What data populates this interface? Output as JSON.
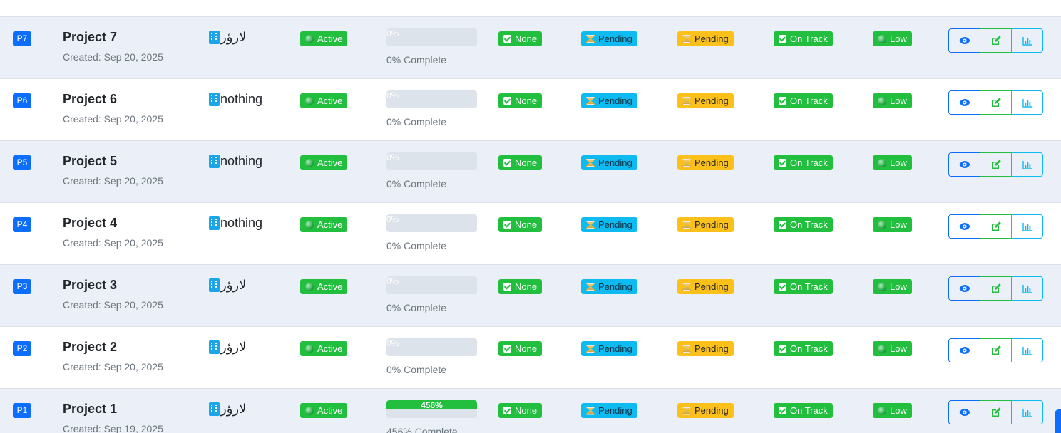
{
  "colors": {
    "primary": "#0d6efd",
    "success": "#22bf3f",
    "info": "#0dbbf0",
    "warning": "#fcc01a",
    "stripe": "#eaeff8"
  },
  "icons": {
    "department": "building-icon",
    "status": "green-dot-icon",
    "check": "check-square-icon",
    "pending": "hourglass-icon",
    "view": "eye-icon",
    "edit": "edit-icon",
    "chart": "bar-chart-icon"
  },
  "rows": [
    {
      "id": "P7",
      "name": "Project 7",
      "created": "Created: Sep 20, 2025",
      "department": "لارؤر",
      "status": "Active",
      "progress_value": 0,
      "progress_label": "0%",
      "progress_text": "0% Complete",
      "issues": "None",
      "approval": "Pending",
      "review": "Pending",
      "timeline": "On Track",
      "priority": "Low"
    },
    {
      "id": "P6",
      "name": "Project 6",
      "created": "Created: Sep 20, 2025",
      "department": "nothing",
      "status": "Active",
      "progress_value": 0,
      "progress_label": "0%",
      "progress_text": "0% Complete",
      "issues": "None",
      "approval": "Pending",
      "review": "Pending",
      "timeline": "On Track",
      "priority": "Low"
    },
    {
      "id": "P5",
      "name": "Project 5",
      "created": "Created: Sep 20, 2025",
      "department": "nothing",
      "status": "Active",
      "progress_value": 0,
      "progress_label": "0%",
      "progress_text": "0% Complete",
      "issues": "None",
      "approval": "Pending",
      "review": "Pending",
      "timeline": "On Track",
      "priority": "Low"
    },
    {
      "id": "P4",
      "name": "Project 4",
      "created": "Created: Sep 20, 2025",
      "department": "nothing",
      "status": "Active",
      "progress_value": 0,
      "progress_label": "0%",
      "progress_text": "0% Complete",
      "issues": "None",
      "approval": "Pending",
      "review": "Pending",
      "timeline": "On Track",
      "priority": "Low"
    },
    {
      "id": "P3",
      "name": "Project 3",
      "created": "Created: Sep 20, 2025",
      "department": "لارؤر",
      "status": "Active",
      "progress_value": 0,
      "progress_label": "0%",
      "progress_text": "0% Complete",
      "issues": "None",
      "approval": "Pending",
      "review": "Pending",
      "timeline": "On Track",
      "priority": "Low"
    },
    {
      "id": "P2",
      "name": "Project 2",
      "created": "Created: Sep 20, 2025",
      "department": "لارؤر",
      "status": "Active",
      "progress_value": 0,
      "progress_label": "0%",
      "progress_text": "0% Complete",
      "issues": "None",
      "approval": "Pending",
      "review": "Pending",
      "timeline": "On Track",
      "priority": "Low"
    },
    {
      "id": "P1",
      "name": "Project 1",
      "created": "Created: Sep 19, 2025",
      "department": "لارؤر",
      "status": "Active",
      "progress_value": 456,
      "progress_label": "456%",
      "progress_text": "456% Complete",
      "issues": "None",
      "approval": "Pending",
      "review": "Pending",
      "timeline": "On Track",
      "priority": "Low"
    }
  ]
}
